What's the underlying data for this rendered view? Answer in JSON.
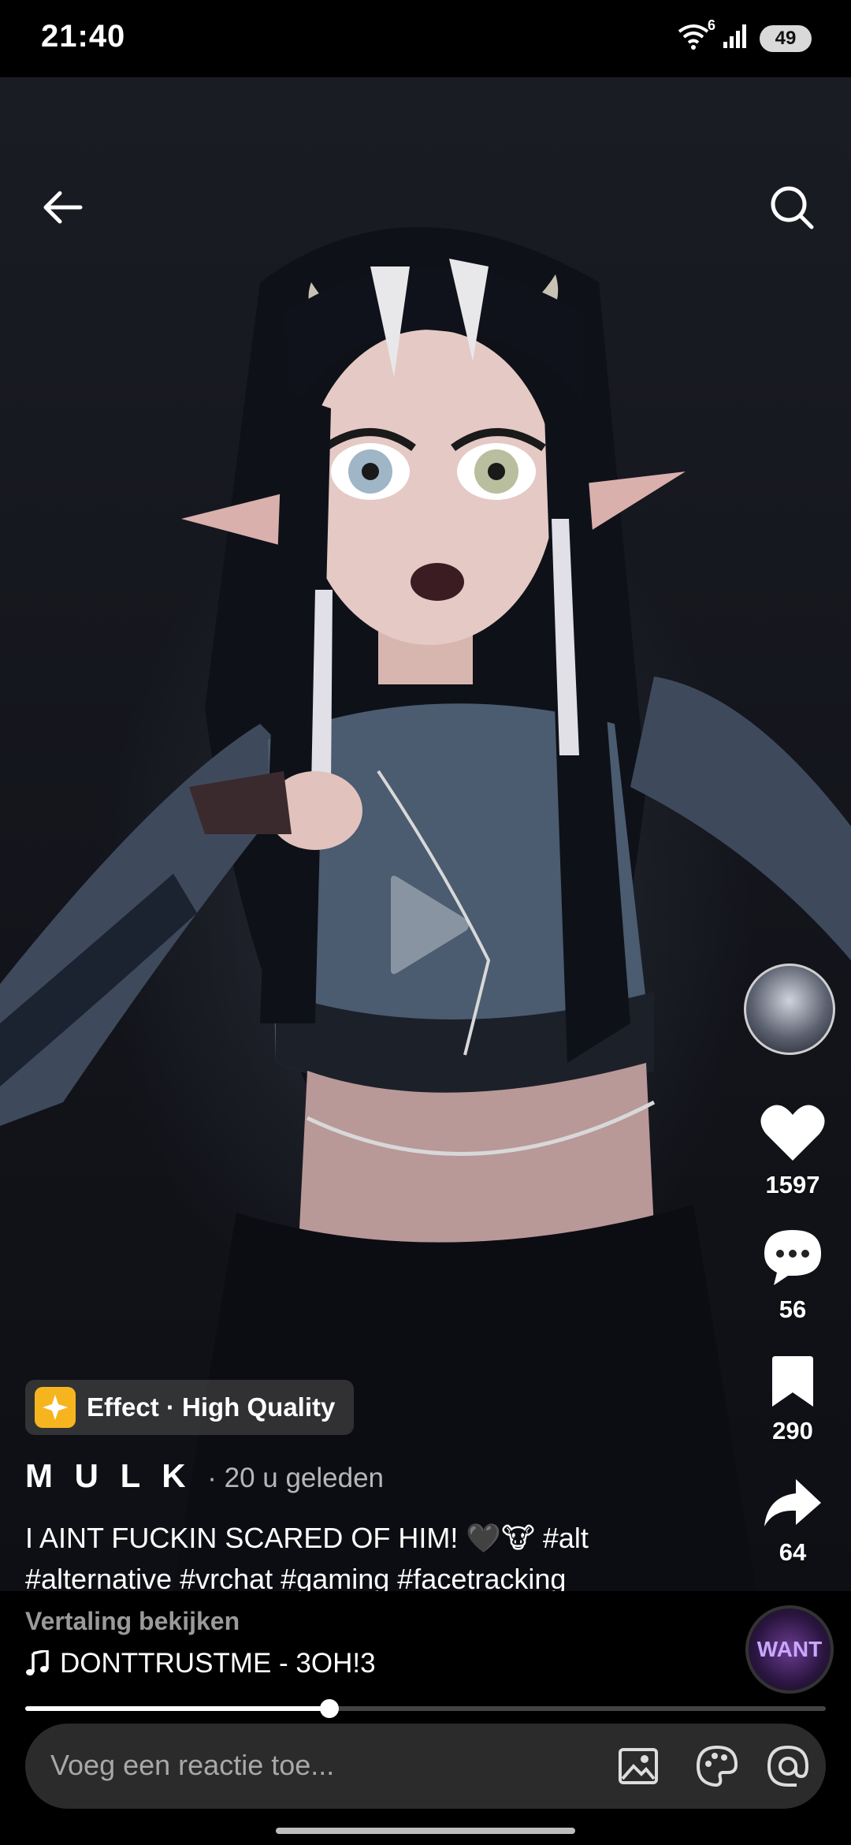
{
  "status_bar": {
    "time": "21:40",
    "battery": "49",
    "wifi_badge": "6"
  },
  "effect": {
    "label": "Effect · High Quality"
  },
  "post": {
    "author": "M U L K",
    "time": "· 20 u geleden",
    "caption": "I AINT FUCKIN SCARED OF HIM! 🖤🐮 #alt #alternative #vrchat #gaming #facetracking",
    "translate": "Vertaling bekijken"
  },
  "stats": {
    "likes": "1597",
    "comments": "56",
    "saves": "290",
    "shares": "64"
  },
  "music": {
    "track": "DONTTRUSTME - 3OH!3",
    "disc_label": "WANT"
  },
  "playback": {
    "progress": 0.38
  },
  "comment": {
    "placeholder": "Voeg een reactie toe..."
  }
}
